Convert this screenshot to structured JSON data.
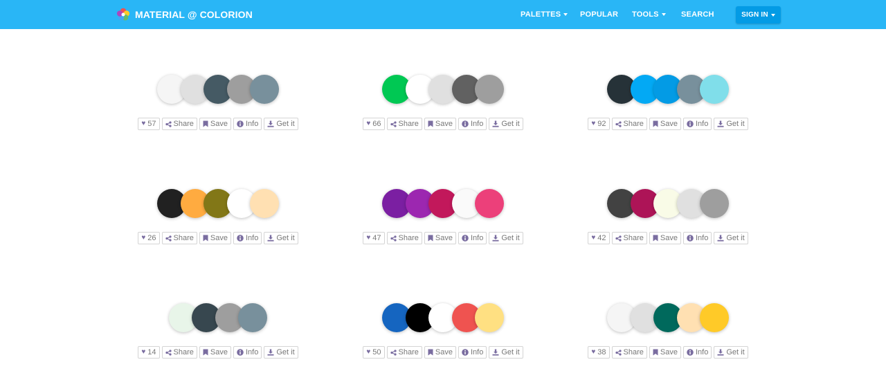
{
  "brand": {
    "name": "MATERIAL @ COLORION"
  },
  "nav": {
    "palettes": "PALETTES",
    "popular": "POPULAR",
    "tools": "TOOLS",
    "search": "SEARCH",
    "signin": "SIGN IN"
  },
  "labels": {
    "share": "Share",
    "save": "Save",
    "info": "Info",
    "get": "Get it"
  },
  "palettes": [
    {
      "likes": "57",
      "colors": [
        "#f5f5f5",
        "#e0e0e0",
        "#455a64",
        "#9e9e9e",
        "#78909c"
      ]
    },
    {
      "likes": "66",
      "colors": [
        "#00c853",
        "#ffffff",
        "#e0e0e0",
        "#616161",
        "#9e9e9e"
      ]
    },
    {
      "likes": "92",
      "colors": [
        "#263238",
        "#03a9f4",
        "#039be5",
        "#78909c",
        "#80deea"
      ]
    },
    {
      "likes": "26",
      "colors": [
        "#212121",
        "#ffab40",
        "#827717",
        "#ffffff",
        "#ffe0b2"
      ]
    },
    {
      "likes": "47",
      "colors": [
        "#7b1fa2",
        "#9c27b0",
        "#c2185b",
        "#fafafa",
        "#ec407a"
      ]
    },
    {
      "likes": "42",
      "colors": [
        "#424242",
        "#ad1457",
        "#f9fbe7",
        "#e0e0e0",
        "#9e9e9e"
      ]
    },
    {
      "likes": "14",
      "colors": [
        "#e8f5e9",
        "#37474f",
        "#9e9e9e",
        "#78909c"
      ]
    },
    {
      "likes": "50",
      "colors": [
        "#1565c0",
        "#000000",
        "#ffffff",
        "#ef5350",
        "#ffe082"
      ]
    },
    {
      "likes": "38",
      "colors": [
        "#f5f5f5",
        "#e0e0e0",
        "#00695c",
        "#ffe0b2",
        "#ffca28"
      ]
    }
  ]
}
